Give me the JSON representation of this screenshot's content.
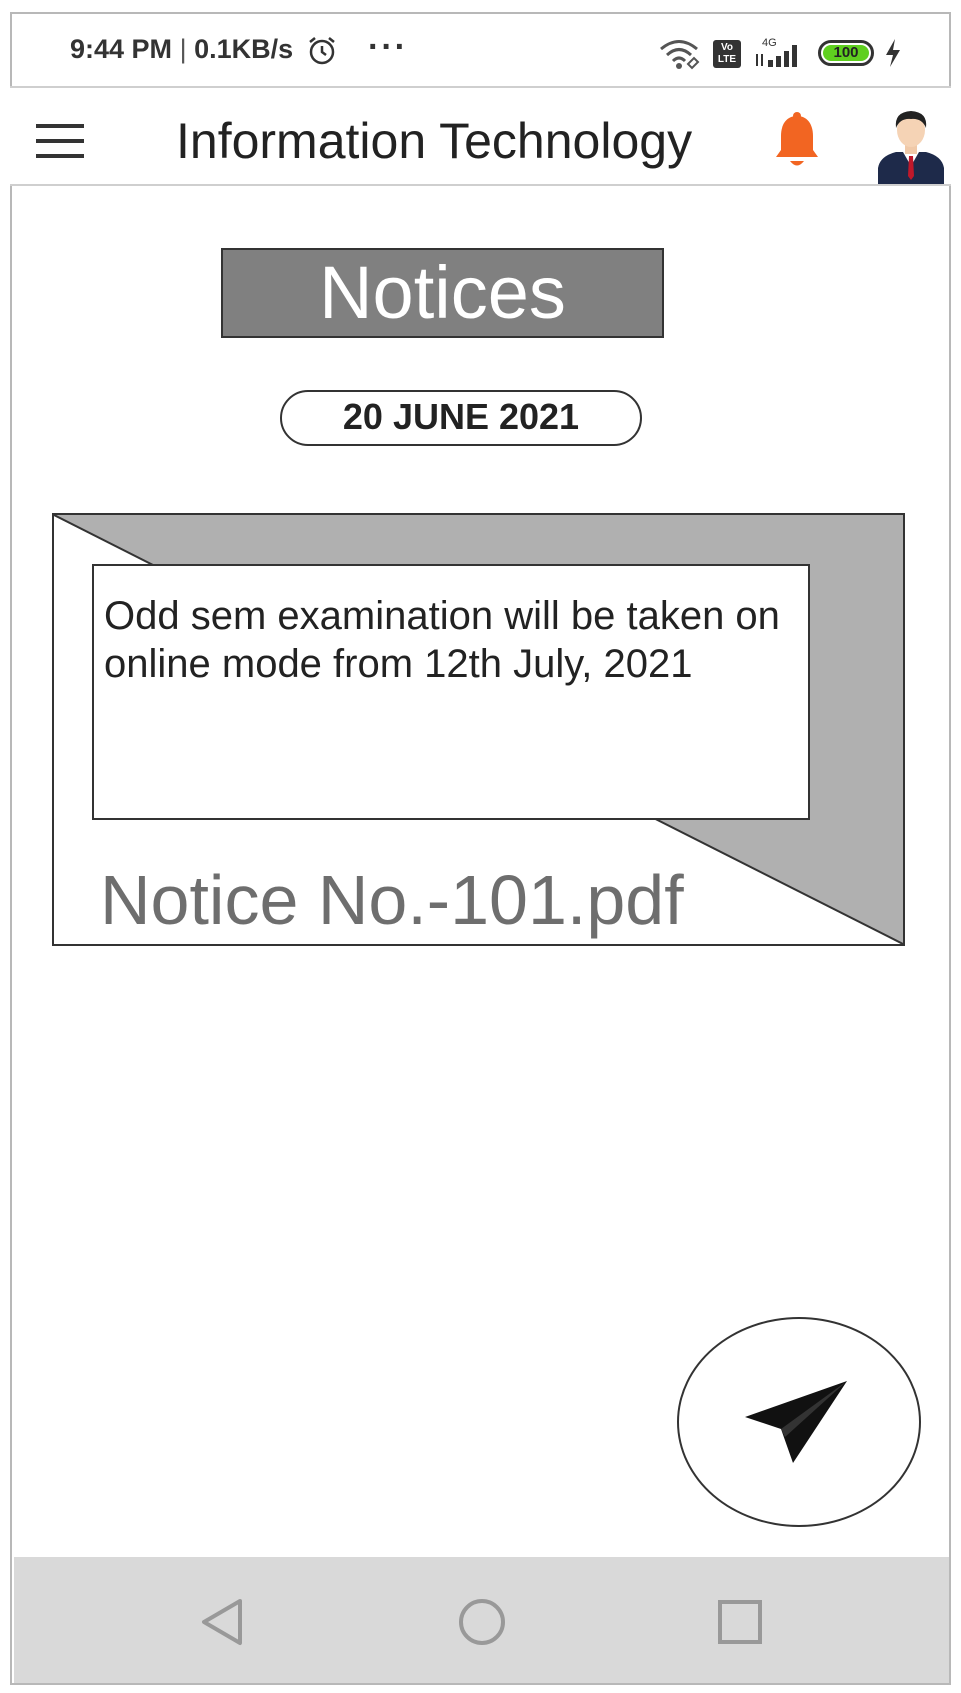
{
  "status_bar": {
    "time": "9:44 PM",
    "separator": "|",
    "network_speed": "0.1KB/s",
    "alarm_icon": "alarm-clock-icon",
    "more_icon": "more-dots-icon",
    "more_label": "···",
    "volte_label": "Vo LTE",
    "network_type": "4G",
    "battery_level": "100",
    "colors": {
      "battery": "#5fcf1f"
    }
  },
  "app_bar": {
    "menu_icon": "hamburger-menu-icon",
    "title": "Information Technology",
    "bell_icon": "notification-bell-icon",
    "avatar_icon": "user-avatar-icon",
    "colors": {
      "bell": "#f26522"
    }
  },
  "main": {
    "header": "Notices",
    "date": "20 JUNE 2021",
    "notices": [
      {
        "text": "Odd sem examination will be taken on online mode from 12th July, 2021",
        "file": "Notice No.-101.pdf"
      }
    ],
    "send_icon": "paper-plane-send-icon"
  },
  "nav_bar": {
    "back_icon": "back-triangle-icon",
    "home_icon": "home-circle-icon",
    "recents_icon": "recents-square-icon"
  }
}
